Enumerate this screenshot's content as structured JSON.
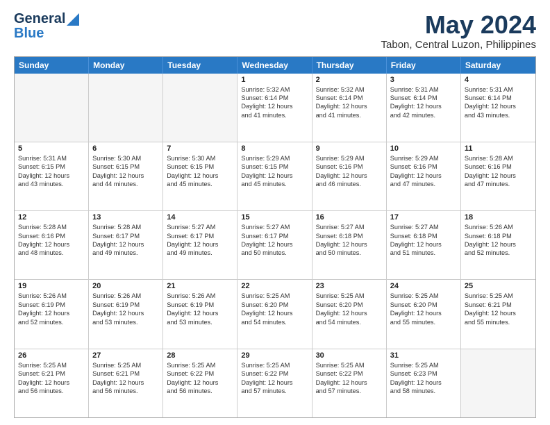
{
  "logo": {
    "line1": "General",
    "line2": "Blue"
  },
  "title": "May 2024",
  "subtitle": "Tabon, Central Luzon, Philippines",
  "header_days": [
    "Sunday",
    "Monday",
    "Tuesday",
    "Wednesday",
    "Thursday",
    "Friday",
    "Saturday"
  ],
  "weeks": [
    [
      {
        "day": "",
        "text": "",
        "empty": true
      },
      {
        "day": "",
        "text": "",
        "empty": true
      },
      {
        "day": "",
        "text": "",
        "empty": true
      },
      {
        "day": "1",
        "text": "Sunrise: 5:32 AM\nSunset: 6:14 PM\nDaylight: 12 hours\nand 41 minutes.",
        "empty": false
      },
      {
        "day": "2",
        "text": "Sunrise: 5:32 AM\nSunset: 6:14 PM\nDaylight: 12 hours\nand 41 minutes.",
        "empty": false
      },
      {
        "day": "3",
        "text": "Sunrise: 5:31 AM\nSunset: 6:14 PM\nDaylight: 12 hours\nand 42 minutes.",
        "empty": false
      },
      {
        "day": "4",
        "text": "Sunrise: 5:31 AM\nSunset: 6:14 PM\nDaylight: 12 hours\nand 43 minutes.",
        "empty": false
      }
    ],
    [
      {
        "day": "5",
        "text": "Sunrise: 5:31 AM\nSunset: 6:15 PM\nDaylight: 12 hours\nand 43 minutes.",
        "empty": false
      },
      {
        "day": "6",
        "text": "Sunrise: 5:30 AM\nSunset: 6:15 PM\nDaylight: 12 hours\nand 44 minutes.",
        "empty": false
      },
      {
        "day": "7",
        "text": "Sunrise: 5:30 AM\nSunset: 6:15 PM\nDaylight: 12 hours\nand 45 minutes.",
        "empty": false
      },
      {
        "day": "8",
        "text": "Sunrise: 5:29 AM\nSunset: 6:15 PM\nDaylight: 12 hours\nand 45 minutes.",
        "empty": false
      },
      {
        "day": "9",
        "text": "Sunrise: 5:29 AM\nSunset: 6:16 PM\nDaylight: 12 hours\nand 46 minutes.",
        "empty": false
      },
      {
        "day": "10",
        "text": "Sunrise: 5:29 AM\nSunset: 6:16 PM\nDaylight: 12 hours\nand 47 minutes.",
        "empty": false
      },
      {
        "day": "11",
        "text": "Sunrise: 5:28 AM\nSunset: 6:16 PM\nDaylight: 12 hours\nand 47 minutes.",
        "empty": false
      }
    ],
    [
      {
        "day": "12",
        "text": "Sunrise: 5:28 AM\nSunset: 6:16 PM\nDaylight: 12 hours\nand 48 minutes.",
        "empty": false
      },
      {
        "day": "13",
        "text": "Sunrise: 5:28 AM\nSunset: 6:17 PM\nDaylight: 12 hours\nand 49 minutes.",
        "empty": false
      },
      {
        "day": "14",
        "text": "Sunrise: 5:27 AM\nSunset: 6:17 PM\nDaylight: 12 hours\nand 49 minutes.",
        "empty": false
      },
      {
        "day": "15",
        "text": "Sunrise: 5:27 AM\nSunset: 6:17 PM\nDaylight: 12 hours\nand 50 minutes.",
        "empty": false
      },
      {
        "day": "16",
        "text": "Sunrise: 5:27 AM\nSunset: 6:18 PM\nDaylight: 12 hours\nand 50 minutes.",
        "empty": false
      },
      {
        "day": "17",
        "text": "Sunrise: 5:27 AM\nSunset: 6:18 PM\nDaylight: 12 hours\nand 51 minutes.",
        "empty": false
      },
      {
        "day": "18",
        "text": "Sunrise: 5:26 AM\nSunset: 6:18 PM\nDaylight: 12 hours\nand 52 minutes.",
        "empty": false
      }
    ],
    [
      {
        "day": "19",
        "text": "Sunrise: 5:26 AM\nSunset: 6:19 PM\nDaylight: 12 hours\nand 52 minutes.",
        "empty": false
      },
      {
        "day": "20",
        "text": "Sunrise: 5:26 AM\nSunset: 6:19 PM\nDaylight: 12 hours\nand 53 minutes.",
        "empty": false
      },
      {
        "day": "21",
        "text": "Sunrise: 5:26 AM\nSunset: 6:19 PM\nDaylight: 12 hours\nand 53 minutes.",
        "empty": false
      },
      {
        "day": "22",
        "text": "Sunrise: 5:25 AM\nSunset: 6:20 PM\nDaylight: 12 hours\nand 54 minutes.",
        "empty": false
      },
      {
        "day": "23",
        "text": "Sunrise: 5:25 AM\nSunset: 6:20 PM\nDaylight: 12 hours\nand 54 minutes.",
        "empty": false
      },
      {
        "day": "24",
        "text": "Sunrise: 5:25 AM\nSunset: 6:20 PM\nDaylight: 12 hours\nand 55 minutes.",
        "empty": false
      },
      {
        "day": "25",
        "text": "Sunrise: 5:25 AM\nSunset: 6:21 PM\nDaylight: 12 hours\nand 55 minutes.",
        "empty": false
      }
    ],
    [
      {
        "day": "26",
        "text": "Sunrise: 5:25 AM\nSunset: 6:21 PM\nDaylight: 12 hours\nand 56 minutes.",
        "empty": false
      },
      {
        "day": "27",
        "text": "Sunrise: 5:25 AM\nSunset: 6:21 PM\nDaylight: 12 hours\nand 56 minutes.",
        "empty": false
      },
      {
        "day": "28",
        "text": "Sunrise: 5:25 AM\nSunset: 6:22 PM\nDaylight: 12 hours\nand 56 minutes.",
        "empty": false
      },
      {
        "day": "29",
        "text": "Sunrise: 5:25 AM\nSunset: 6:22 PM\nDaylight: 12 hours\nand 57 minutes.",
        "empty": false
      },
      {
        "day": "30",
        "text": "Sunrise: 5:25 AM\nSunset: 6:22 PM\nDaylight: 12 hours\nand 57 minutes.",
        "empty": false
      },
      {
        "day": "31",
        "text": "Sunrise: 5:25 AM\nSunset: 6:23 PM\nDaylight: 12 hours\nand 58 minutes.",
        "empty": false
      },
      {
        "day": "",
        "text": "",
        "empty": true
      }
    ]
  ]
}
